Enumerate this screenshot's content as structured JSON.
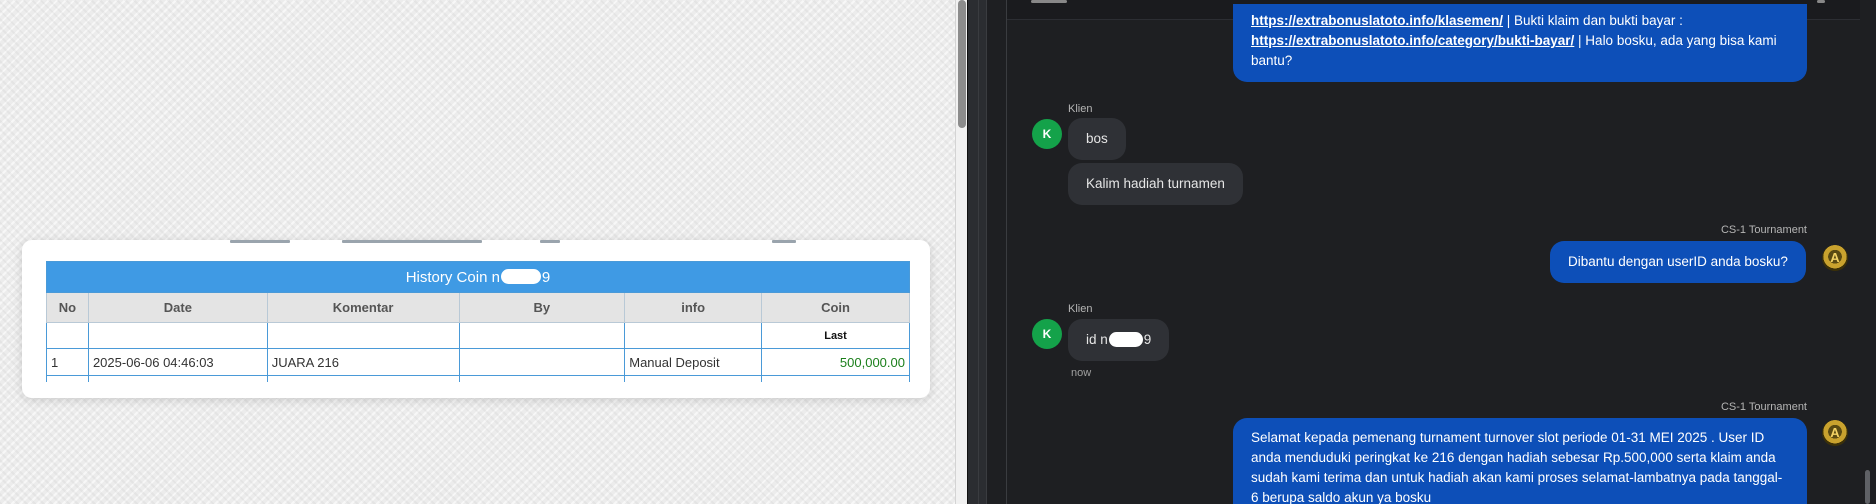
{
  "left": {
    "table": {
      "title_prefix": "History Coin n",
      "title_suffix": "9",
      "columns": [
        "No",
        "Date",
        "Komentar",
        "By",
        "info",
        "Coin"
      ],
      "sub_header": "Last",
      "rows": [
        {
          "no": "1",
          "date": "2025-06-06 04:46:03",
          "komentar": "JUARA 216",
          "by": "",
          "info": "Manual Deposit",
          "coin": "500,000.00"
        }
      ]
    }
  },
  "chat": {
    "first_message": {
      "line1_link": "https://extrabonuslatoto.info/klasemen/",
      "line1_text": " | Bukti klaim dan bukti bayar :",
      "line2_link": "https://extrabonuslatoto.info/category/bukti-bayar/",
      "line2_text": " | Halo bosku, ada yang bisa kami",
      "line3_text": "bantu?"
    },
    "client_name": "Klien",
    "client_avatar_letter": "K",
    "client_msg_1": "bos",
    "client_msg_2": "Kalim hadiah turnamen",
    "agent_name": "CS-1 Tournament",
    "agent_msg_1": "Dibantu dengan userID anda bosku?",
    "client_msg_3_prefix": "id n",
    "client_msg_3_suffix": "9",
    "timestamp": "now",
    "agent_msg_2": "Selamat kepada pemenang turnament turnover slot periode 01-31 MEI 2025 . User ID anda menduduki peringkat ke 216 dengan hadiah sebesar Rp.500,000 serta klaim anda sudah kami terima dan untuk hadiah akan kami proses selamat-lambatnya pada tanggal- 6 berupa saldo akun ya bosku",
    "agent_avatar_letter": "A"
  },
  "colors": {
    "table_header_blue": "#3f9ae4",
    "agent_bubble": "#0d4fb8",
    "client_bubble": "#2f3136",
    "client_avatar": "#14a24a",
    "coin_green": "#1b7f1b"
  }
}
